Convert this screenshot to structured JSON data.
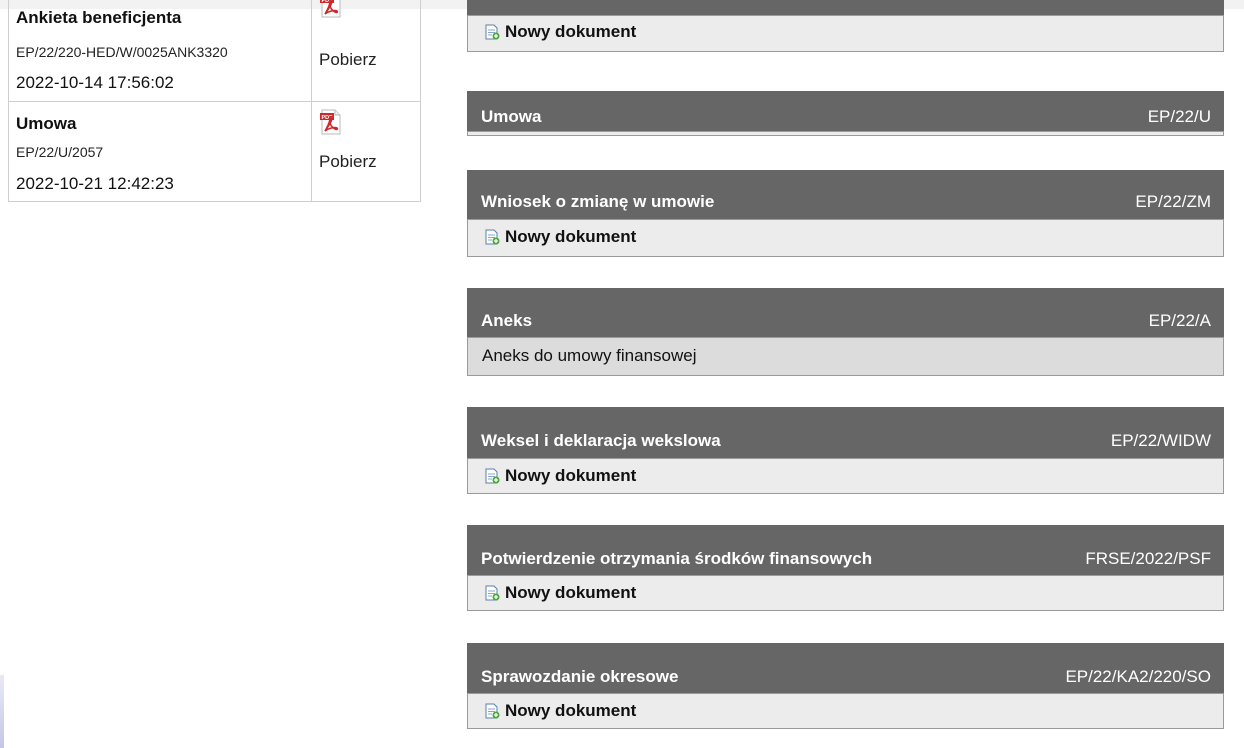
{
  "documents": [
    {
      "title": "Ankieta beneficjenta",
      "number": "EP/22/220-HED/W/0025ANK3320",
      "date": "2022-10-14 17:56:02",
      "download_label": "Pobierz"
    },
    {
      "title": "Umowa",
      "number": "EP/22/U/2057",
      "date": "2022-10-21 12:42:23",
      "download_label": "Pobierz"
    }
  ],
  "categories": [
    {
      "title": "",
      "code": "",
      "action_label": "Nowy dokument"
    },
    {
      "title": "Umowa",
      "code": "EP/22/U"
    },
    {
      "title": "Wniosek o zmianę w umowie",
      "code": "EP/22/ZM",
      "action_label": "Nowy dokument"
    },
    {
      "title": "Aneks",
      "code": "EP/22/A",
      "item_label": "Aneks do umowy finansowej"
    },
    {
      "title": "Weksel i deklaracja wekslowa",
      "code": "EP/22/WIDW",
      "action_label": "Nowy dokument"
    },
    {
      "title": "Potwierdzenie otrzymania środków finansowych",
      "code": "FRSE/2022/PSF",
      "action_label": "Nowy dokument"
    },
    {
      "title": "Sprawozdanie okresowe",
      "code": "EP/22/KA2/220/SO",
      "action_label": "Nowy dokument"
    }
  ],
  "icons": {
    "pdf": "pdf-file-icon",
    "new_document": "new-document-icon"
  },
  "colors": {
    "header_bg": "#666666",
    "body_bg": "#ececec",
    "pdf_red": "#d0282a"
  }
}
